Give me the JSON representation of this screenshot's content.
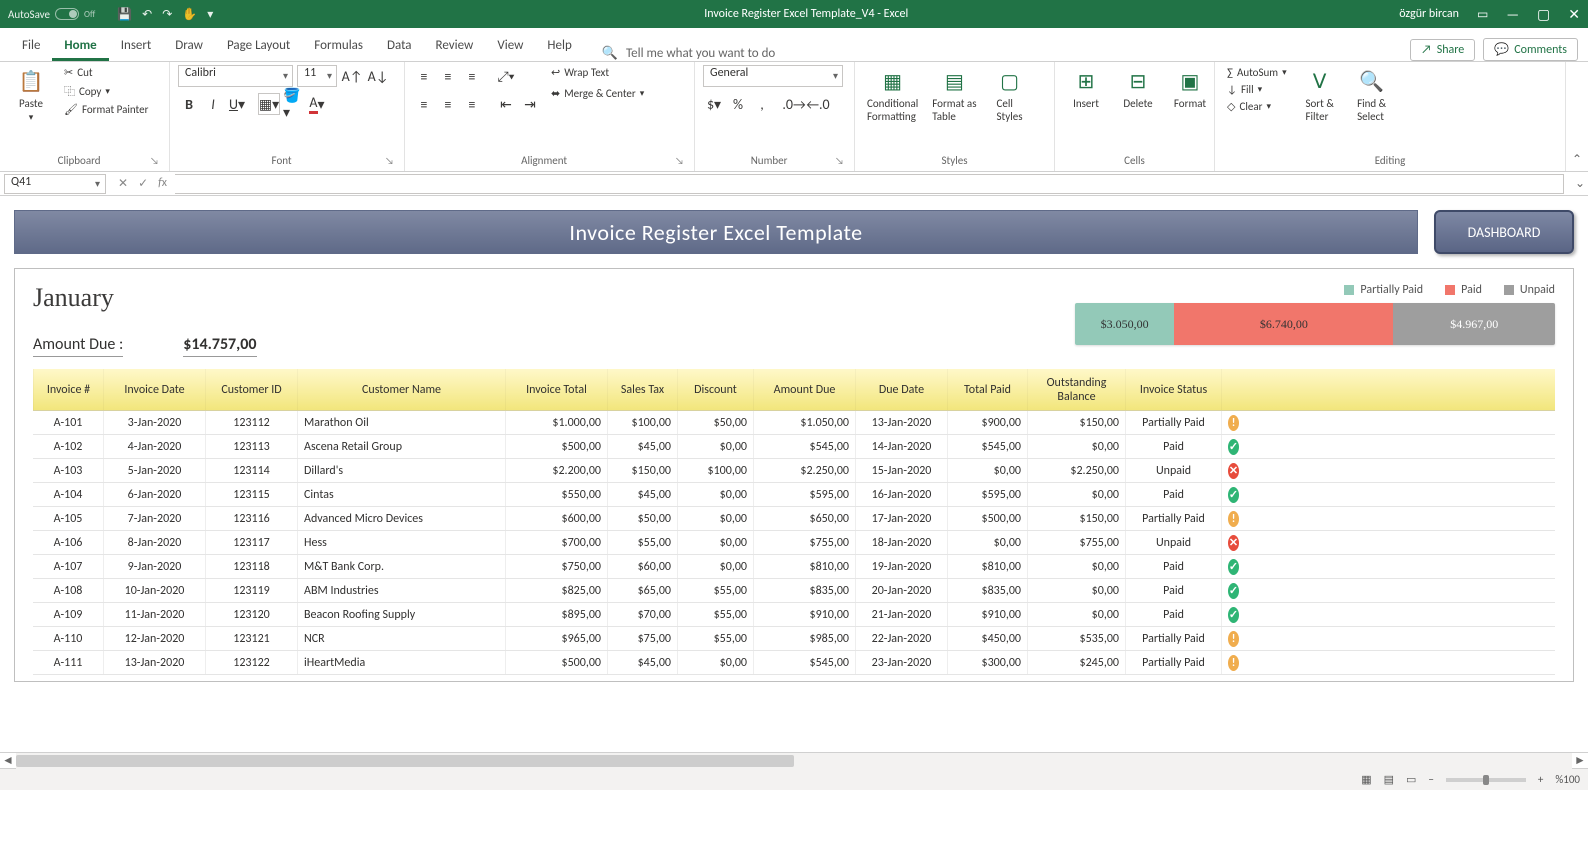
{
  "titlebar": {
    "autosave": "AutoSave",
    "autosave_state": "Off",
    "title": "Invoice Register Excel Template_V4  -  Excel",
    "user": "özgür bircan"
  },
  "tabs": {
    "items": [
      "File",
      "Home",
      "Insert",
      "Draw",
      "Page Layout",
      "Formulas",
      "Data",
      "Review",
      "View",
      "Help"
    ],
    "active": "Home",
    "tell_me": "Tell me what you want to do",
    "share": "Share",
    "comments": "Comments"
  },
  "ribbon": {
    "clipboard": {
      "paste": "Paste",
      "cut": "Cut",
      "copy": "Copy",
      "fp": "Format Painter",
      "label": "Clipboard"
    },
    "font": {
      "name": "Calibri",
      "size": "11",
      "label": "Font"
    },
    "alignment": {
      "wrap": "Wrap Text",
      "merge": "Merge & Center",
      "label": "Alignment"
    },
    "number": {
      "format": "General",
      "label": "Number"
    },
    "styles": {
      "cond": "Conditional\nFormatting",
      "fat": "Format as\nTable",
      "cs": "Cell\nStyles",
      "label": "Styles"
    },
    "cells": {
      "ins": "Insert",
      "del": "Delete",
      "fmt": "Format",
      "label": "Cells"
    },
    "editing": {
      "sum": "AutoSum",
      "fill": "Fill",
      "clear": "Clear",
      "sort": "Sort &\nFilter",
      "find": "Find &\nSelect",
      "label": "Editing"
    }
  },
  "formulabar": {
    "namebox": "Q41",
    "formula": ""
  },
  "sheet": {
    "banner_title": "Invoice Register Excel Template",
    "dashboard_btn": "DASHBOARD",
    "month": "January",
    "amount_due_label": "Amount Due :",
    "amount_due_value": "$14.757,00"
  },
  "chart_data": {
    "type": "bar",
    "title": "",
    "categories": [
      "Partially Paid",
      "Paid",
      "Unpaid"
    ],
    "values": [
      3050.0,
      6740.0,
      4967.0
    ],
    "labels": [
      "$3.050,00",
      "$6.740,00",
      "$4.967,00"
    ],
    "colors": [
      "#93c9b8",
      "#f1766b",
      "#9e9e9e"
    ],
    "xlabel": "",
    "ylabel": "",
    "ylim": [
      0,
      14757
    ]
  },
  "legend": {
    "partial": "Partially Paid",
    "paid": "Paid",
    "unpaid": "Unpaid"
  },
  "table": {
    "headers": [
      "Invoice #",
      "Invoice Date",
      "Customer ID",
      "Customer Name",
      "Invoice Total",
      "Sales Tax",
      "Discount",
      "Amount Due",
      "Due Date",
      "Total Paid",
      "Outstanding Balance",
      "Invoice Status"
    ],
    "rows": [
      {
        "inv": "A-101",
        "date": "3-Jan-2020",
        "cid": "123112",
        "cname": "Marathon Oil",
        "total": "$1.000,00",
        "tax": "$100,00",
        "disc": "$50,00",
        "due": "$1.050,00",
        "ddate": "13-Jan-2020",
        "paid": "$900,00",
        "bal": "$150,00",
        "status": "Partially Paid",
        "icon": "warn"
      },
      {
        "inv": "A-102",
        "date": "4-Jan-2020",
        "cid": "123113",
        "cname": "Ascena Retail Group",
        "total": "$500,00",
        "tax": "$45,00",
        "disc": "$0,00",
        "due": "$545,00",
        "ddate": "14-Jan-2020",
        "paid": "$545,00",
        "bal": "$0,00",
        "status": "Paid",
        "icon": "ok"
      },
      {
        "inv": "A-103",
        "date": "5-Jan-2020",
        "cid": "123114",
        "cname": "Dillard's",
        "total": "$2.200,00",
        "tax": "$150,00",
        "disc": "$100,00",
        "due": "$2.250,00",
        "ddate": "15-Jan-2020",
        "paid": "$0,00",
        "bal": "$2.250,00",
        "status": "Unpaid",
        "icon": "bad"
      },
      {
        "inv": "A-104",
        "date": "6-Jan-2020",
        "cid": "123115",
        "cname": "Cintas",
        "total": "$550,00",
        "tax": "$45,00",
        "disc": "$0,00",
        "due": "$595,00",
        "ddate": "16-Jan-2020",
        "paid": "$595,00",
        "bal": "$0,00",
        "status": "Paid",
        "icon": "ok"
      },
      {
        "inv": "A-105",
        "date": "7-Jan-2020",
        "cid": "123116",
        "cname": "Advanced Micro Devices",
        "total": "$600,00",
        "tax": "$50,00",
        "disc": "$0,00",
        "due": "$650,00",
        "ddate": "17-Jan-2020",
        "paid": "$500,00",
        "bal": "$150,00",
        "status": "Partially Paid",
        "icon": "warn"
      },
      {
        "inv": "A-106",
        "date": "8-Jan-2020",
        "cid": "123117",
        "cname": "Hess",
        "total": "$700,00",
        "tax": "$55,00",
        "disc": "$0,00",
        "due": "$755,00",
        "ddate": "18-Jan-2020",
        "paid": "$0,00",
        "bal": "$755,00",
        "status": "Unpaid",
        "icon": "bad"
      },
      {
        "inv": "A-107",
        "date": "9-Jan-2020",
        "cid": "123118",
        "cname": "M&T Bank Corp.",
        "total": "$750,00",
        "tax": "$60,00",
        "disc": "$0,00",
        "due": "$810,00",
        "ddate": "19-Jan-2020",
        "paid": "$810,00",
        "bal": "$0,00",
        "status": "Paid",
        "icon": "ok"
      },
      {
        "inv": "A-108",
        "date": "10-Jan-2020",
        "cid": "123119",
        "cname": "ABM Industries",
        "total": "$825,00",
        "tax": "$65,00",
        "disc": "$55,00",
        "due": "$835,00",
        "ddate": "20-Jan-2020",
        "paid": "$835,00",
        "bal": "$0,00",
        "status": "Paid",
        "icon": "ok"
      },
      {
        "inv": "A-109",
        "date": "11-Jan-2020",
        "cid": "123120",
        "cname": "Beacon Roofing Supply",
        "total": "$895,00",
        "tax": "$70,00",
        "disc": "$55,00",
        "due": "$910,00",
        "ddate": "21-Jan-2020",
        "paid": "$910,00",
        "bal": "$0,00",
        "status": "Paid",
        "icon": "ok"
      },
      {
        "inv": "A-110",
        "date": "12-Jan-2020",
        "cid": "123121",
        "cname": "NCR",
        "total": "$965,00",
        "tax": "$75,00",
        "disc": "$55,00",
        "due": "$985,00",
        "ddate": "22-Jan-2020",
        "paid": "$450,00",
        "bal": "$535,00",
        "status": "Partially Paid",
        "icon": "warn"
      },
      {
        "inv": "A-111",
        "date": "13-Jan-2020",
        "cid": "123122",
        "cname": "iHeartMedia",
        "total": "$500,00",
        "tax": "$45,00",
        "disc": "$0,00",
        "due": "$545,00",
        "ddate": "23-Jan-2020",
        "paid": "$300,00",
        "bal": "$245,00",
        "status": "Partially Paid",
        "icon": "warn"
      }
    ]
  },
  "statusbar": {
    "zoom": "%100"
  }
}
